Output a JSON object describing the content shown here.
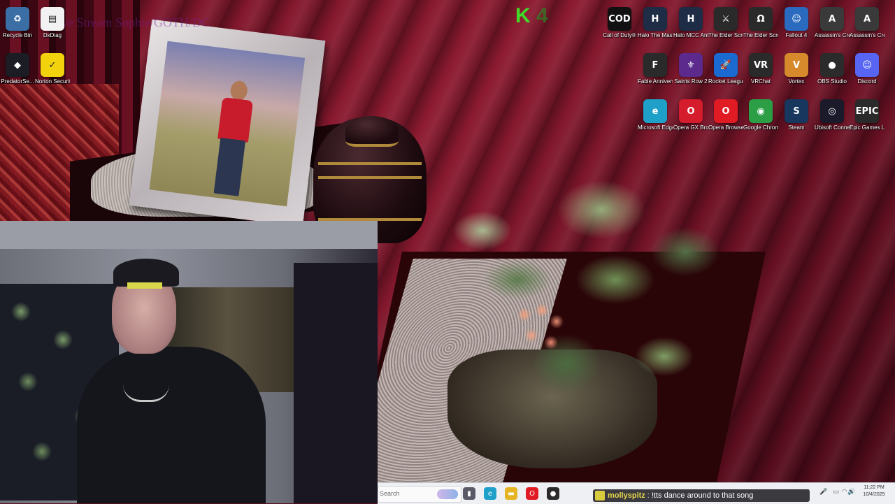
{
  "wallpaper": {
    "overlay_text": "Live Stream Sophie/GOTH/DC"
  },
  "stream_logo": {
    "letter": "K",
    "letter2": "4"
  },
  "desktop_icons": [
    {
      "label": "Recycle Bin",
      "icon": "recycle-bin-icon",
      "color": "#3a6ea5",
      "glyph": "♻"
    },
    {
      "label": "DxDiag",
      "icon": "document-icon",
      "color": "#f2f2f2",
      "glyph": "▤"
    },
    {
      "label": "PredatorSe...",
      "icon": "predator-sense-icon",
      "color": "#1c1c24",
      "glyph": "◆"
    },
    {
      "label": "Norton Security Ultra",
      "icon": "norton-icon",
      "color": "#f2d20c",
      "glyph": "✓"
    },
    {
      "label": "Call of Duty®",
      "icon": "call-of-duty-icon",
      "color": "#111111",
      "glyph": "COD"
    },
    {
      "label": "Halo The Master Chi...",
      "icon": "halo-mcc-icon",
      "color": "#1f2c46",
      "glyph": "H"
    },
    {
      "label": "Halo MCC Anti-Che...",
      "icon": "halo-anticheat-icon",
      "color": "#1f2c46",
      "glyph": "H"
    },
    {
      "label": "The Elder Scrolls ...",
      "icon": "elder-scrolls-icon",
      "color": "#2a2a2a",
      "glyph": "⚔"
    },
    {
      "label": "The Elder Scrolls IV ...",
      "icon": "oblivion-icon",
      "color": "#2a2a2a",
      "glyph": "Ω"
    },
    {
      "label": "Fallout 4",
      "icon": "fallout-icon",
      "color": "#2b6bbf",
      "glyph": "☺"
    },
    {
      "label": "Assassin's Creed O...",
      "icon": "assassins-creed-icon",
      "color": "#3a3a3a",
      "glyph": "A"
    },
    {
      "label": "Assassin's Creed Mirage",
      "icon": "assassins-creed-mirage-icon",
      "color": "#3a3a3a",
      "glyph": "A"
    },
    {
      "label": "Fable Anniversary",
      "icon": "fable-icon",
      "color": "#2a2a2a",
      "glyph": "F"
    },
    {
      "label": "Saints Row 2",
      "icon": "saints-row-icon",
      "color": "#5c2a8c",
      "glyph": "⚜"
    },
    {
      "label": "Rocket League®",
      "icon": "rocket-league-icon",
      "color": "#1a6ad1",
      "glyph": "🚀"
    },
    {
      "label": "VRChat",
      "icon": "vrchat-icon",
      "color": "#2a2a2a",
      "glyph": "VR"
    },
    {
      "label": "Vortex",
      "icon": "vortex-icon",
      "color": "#d68a2c",
      "glyph": "V"
    },
    {
      "label": "OBS Studio",
      "icon": "obs-studio-icon",
      "color": "#2b2b2b",
      "glyph": "●"
    },
    {
      "label": "Discord",
      "icon": "discord-icon",
      "color": "#5865f2",
      "glyph": "☺"
    },
    {
      "label": "Microsoft Edge",
      "icon": "edge-icon",
      "color": "#1fa0c8",
      "glyph": "e"
    },
    {
      "label": "Opera GX Browser",
      "icon": "opera-gx-icon",
      "color": "#d41c2c",
      "glyph": "O"
    },
    {
      "label": "Opera Browser",
      "icon": "opera-icon",
      "color": "#e01b24",
      "glyph": "O"
    },
    {
      "label": "Google Chrome",
      "icon": "chrome-icon",
      "color": "#2b9e46",
      "glyph": "◉"
    },
    {
      "label": "Steam",
      "icon": "steam-icon",
      "color": "#17375e",
      "glyph": "S"
    },
    {
      "label": "Ubisoft Connect",
      "icon": "ubisoft-icon",
      "color": "#1a1a2a",
      "glyph": "◎"
    },
    {
      "label": "Epic Games Launcher",
      "icon": "epic-games-icon",
      "color": "#2a2a2a",
      "glyph": "EPIC"
    }
  ],
  "taskbar": {
    "search_placeholder": "Search",
    "apps": [
      {
        "icon": "task-view-icon",
        "color": "#5a5a66",
        "glyph": "▮"
      },
      {
        "icon": "edge-icon",
        "color": "#1fa0c8",
        "glyph": "e"
      },
      {
        "icon": "file-explorer-icon",
        "color": "#e6b422",
        "glyph": "▬"
      },
      {
        "icon": "opera-icon",
        "color": "#e01b24",
        "glyph": "O"
      },
      {
        "icon": "obs-studio-icon",
        "color": "#2b2b2b",
        "glyph": "●"
      }
    ]
  },
  "chat_overlay": {
    "username": "mollyspitz",
    "separator": ":",
    "message": "!tts dance around to that song"
  },
  "tray": {
    "icons": [
      "chevron-up-icon",
      "mic-icon",
      "network-icon",
      "wifi-icon",
      "volume-icon"
    ],
    "time": "11:22 PM",
    "date": "10/4/2025"
  },
  "colors": {
    "taskbar_bg": "#eef0f4",
    "chat_user": "#e6d94a",
    "stream_logo": "#3fdc28"
  }
}
